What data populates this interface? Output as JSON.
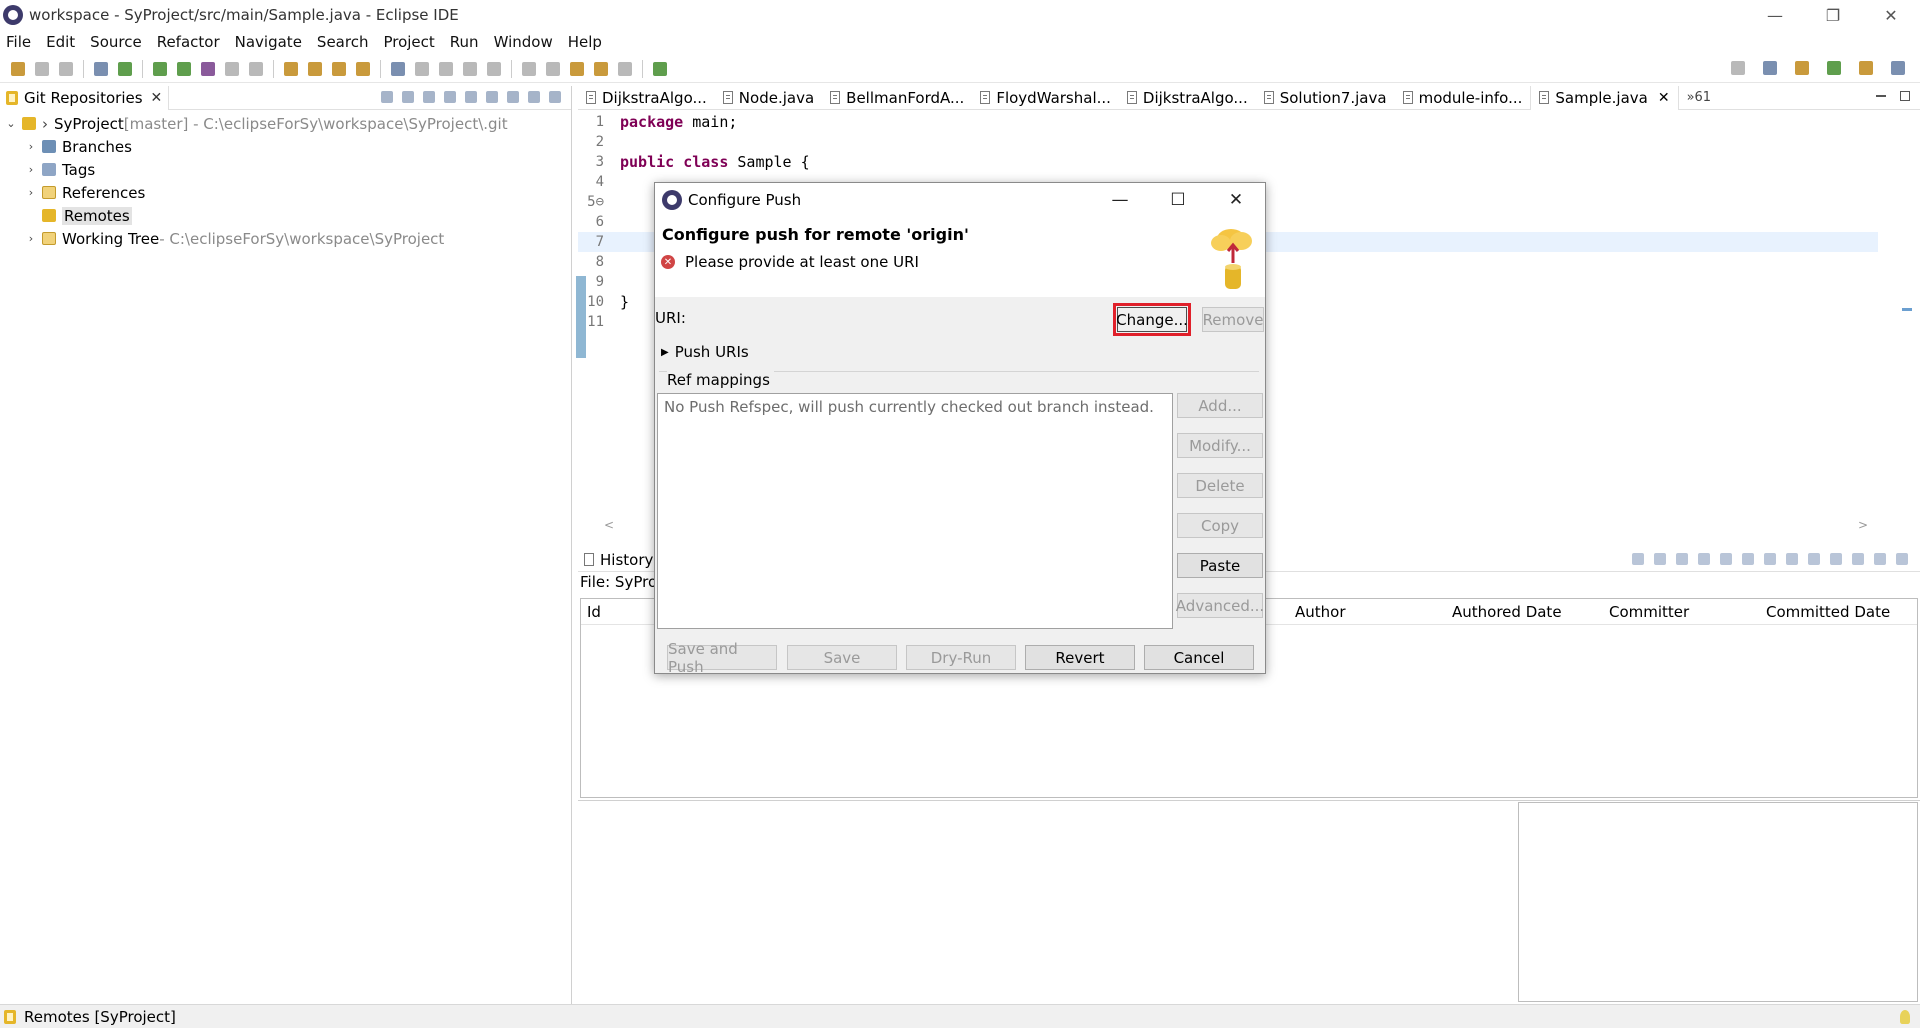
{
  "window": {
    "title": "workspace - SyProject/src/main/Sample.java - Eclipse IDE",
    "minimize": "—",
    "restore": "❐",
    "close": "✕"
  },
  "menu": [
    "File",
    "Edit",
    "Source",
    "Refactor",
    "Navigate",
    "Search",
    "Project",
    "Run",
    "Window",
    "Help"
  ],
  "left_panel": {
    "tab_label": "Git Repositories",
    "tree": [
      {
        "arrow": "⌄",
        "label": "SyProject",
        "extra": " [master] - C:\\eclipseForSy\\workspace\\SyProject\\.git",
        "icon": "repo",
        "indent": 0
      },
      {
        "arrow": "›",
        "label": "Branches",
        "extra": "",
        "icon": "branch",
        "indent": 1
      },
      {
        "arrow": "›",
        "label": "Tags",
        "extra": "",
        "icon": "tag",
        "indent": 1
      },
      {
        "arrow": "›",
        "label": "References",
        "extra": "",
        "icon": "folder",
        "indent": 1
      },
      {
        "arrow": "",
        "label": "Remotes",
        "extra": "",
        "icon": "repo",
        "indent": 1
      },
      {
        "arrow": "›",
        "label": "Working Tree",
        "extra": " - C:\\eclipseForSy\\workspace\\SyProject",
        "icon": "folder",
        "indent": 1
      }
    ]
  },
  "editor": {
    "tabs": [
      "DijkstraAlgo...",
      "Node.java",
      "BellmanFordA...",
      "FloydWarshal...",
      "DijkstraAlgo...",
      "Solution7.java",
      "module-info...",
      "Sample.java"
    ],
    "active_tab": "Sample.java",
    "overflow": "»61",
    "lines": [
      {
        "n": "1",
        "kw": "package",
        "rest": " main;"
      },
      {
        "n": "2",
        "kw": "",
        "rest": ""
      },
      {
        "n": "3",
        "kw": "public class",
        "rest": " Sample {"
      },
      {
        "n": "4",
        "kw": "",
        "rest": ""
      },
      {
        "n": "5⊖",
        "kw": "",
        "rest": ""
      },
      {
        "n": "6",
        "kw": "",
        "rest": ""
      },
      {
        "n": "7",
        "kw": "",
        "rest": ""
      },
      {
        "n": "8",
        "kw": "",
        "rest": ""
      },
      {
        "n": "9",
        "kw": "",
        "rest": ""
      },
      {
        "n": "10",
        "kw": "",
        "rest": "}"
      },
      {
        "n": "11",
        "kw": "",
        "rest": ""
      }
    ],
    "scroll_left": "<",
    "scroll_right": ">"
  },
  "history": {
    "tab_label": "History",
    "file_label": "File: SyProj",
    "columns": [
      {
        "key": "id",
        "label": "Id"
      },
      {
        "key": "author",
        "label": "Author"
      },
      {
        "key": "authored",
        "label": "Authored Date"
      },
      {
        "key": "committer",
        "label": "Committer"
      },
      {
        "key": "committed",
        "label": "Committed Date"
      }
    ]
  },
  "statusbar": {
    "text": "Remotes [SyProject]"
  },
  "dialog": {
    "title": "Configure Push",
    "heading": "Configure push for remote 'origin'",
    "error": "Please provide at least one URI",
    "uri_label": "URI:",
    "change_button": "Change...",
    "remove_button": "Remove",
    "push_uris_label": "Push URIs",
    "ref_mappings_label": "Ref mappings",
    "ref_placeholder": "No Push Refspec, will push currently checked out branch instead.",
    "side_buttons": {
      "add": "Add...",
      "modify": "Modify...",
      "delete": "Delete",
      "copy": "Copy",
      "paste": "Paste",
      "advanced": "Advanced..."
    },
    "footer_buttons": {
      "save_and_push": "Save and Push",
      "save": "Save",
      "dry_run": "Dry-Run",
      "revert": "Revert",
      "cancel": "Cancel"
    },
    "accent_color": "#e0202a"
  }
}
